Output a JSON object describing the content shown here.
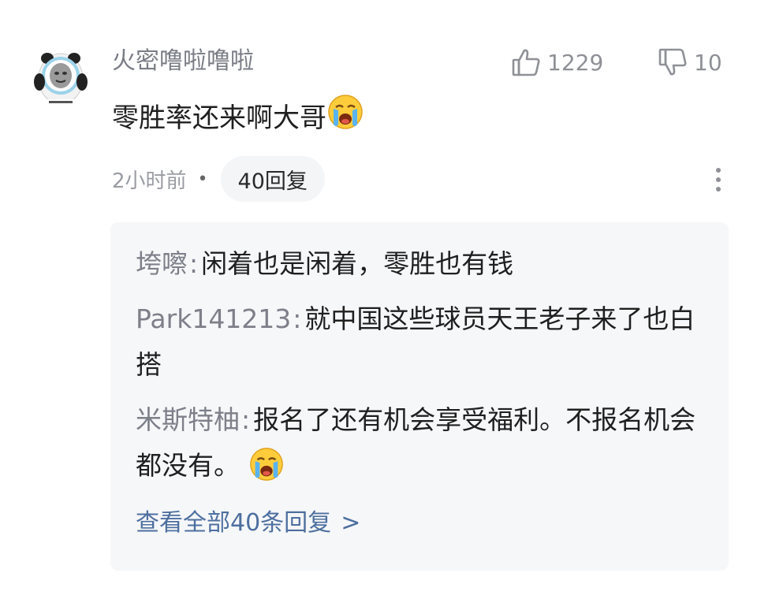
{
  "comment": {
    "username": "火密噜啦噜啦",
    "text": "零胜率还来啊大哥",
    "emoji": "crying-face-emoji",
    "likes": "1229",
    "dislikes": "10",
    "time": "2小时前",
    "dot": "•",
    "reply_count_label": "40回复"
  },
  "replies": {
    "items": [
      {
        "name": "垮嚓",
        "sep": ":",
        "text": "闲着也是闲着，零胜也有钱"
      },
      {
        "name": "Park141213",
        "sep": ":",
        "text": "就中国这些球员天王老子来了也白搭"
      },
      {
        "name": "米斯特柚",
        "sep": ":",
        "text": "报名了还有机会享受福利。不报名机会都没有。"
      }
    ],
    "view_all": "查看全部40条回复",
    "view_all_chevron": ">"
  },
  "icons": {
    "like": "thumbs-up-icon",
    "dislike": "thumbs-down-icon",
    "more": "more-vertical-icon"
  },
  "colors": {
    "username": "#7a7d85",
    "reply_bg": "#f6f7f9",
    "link": "#4d6f9f",
    "pill_bg": "#f4f5f7"
  }
}
